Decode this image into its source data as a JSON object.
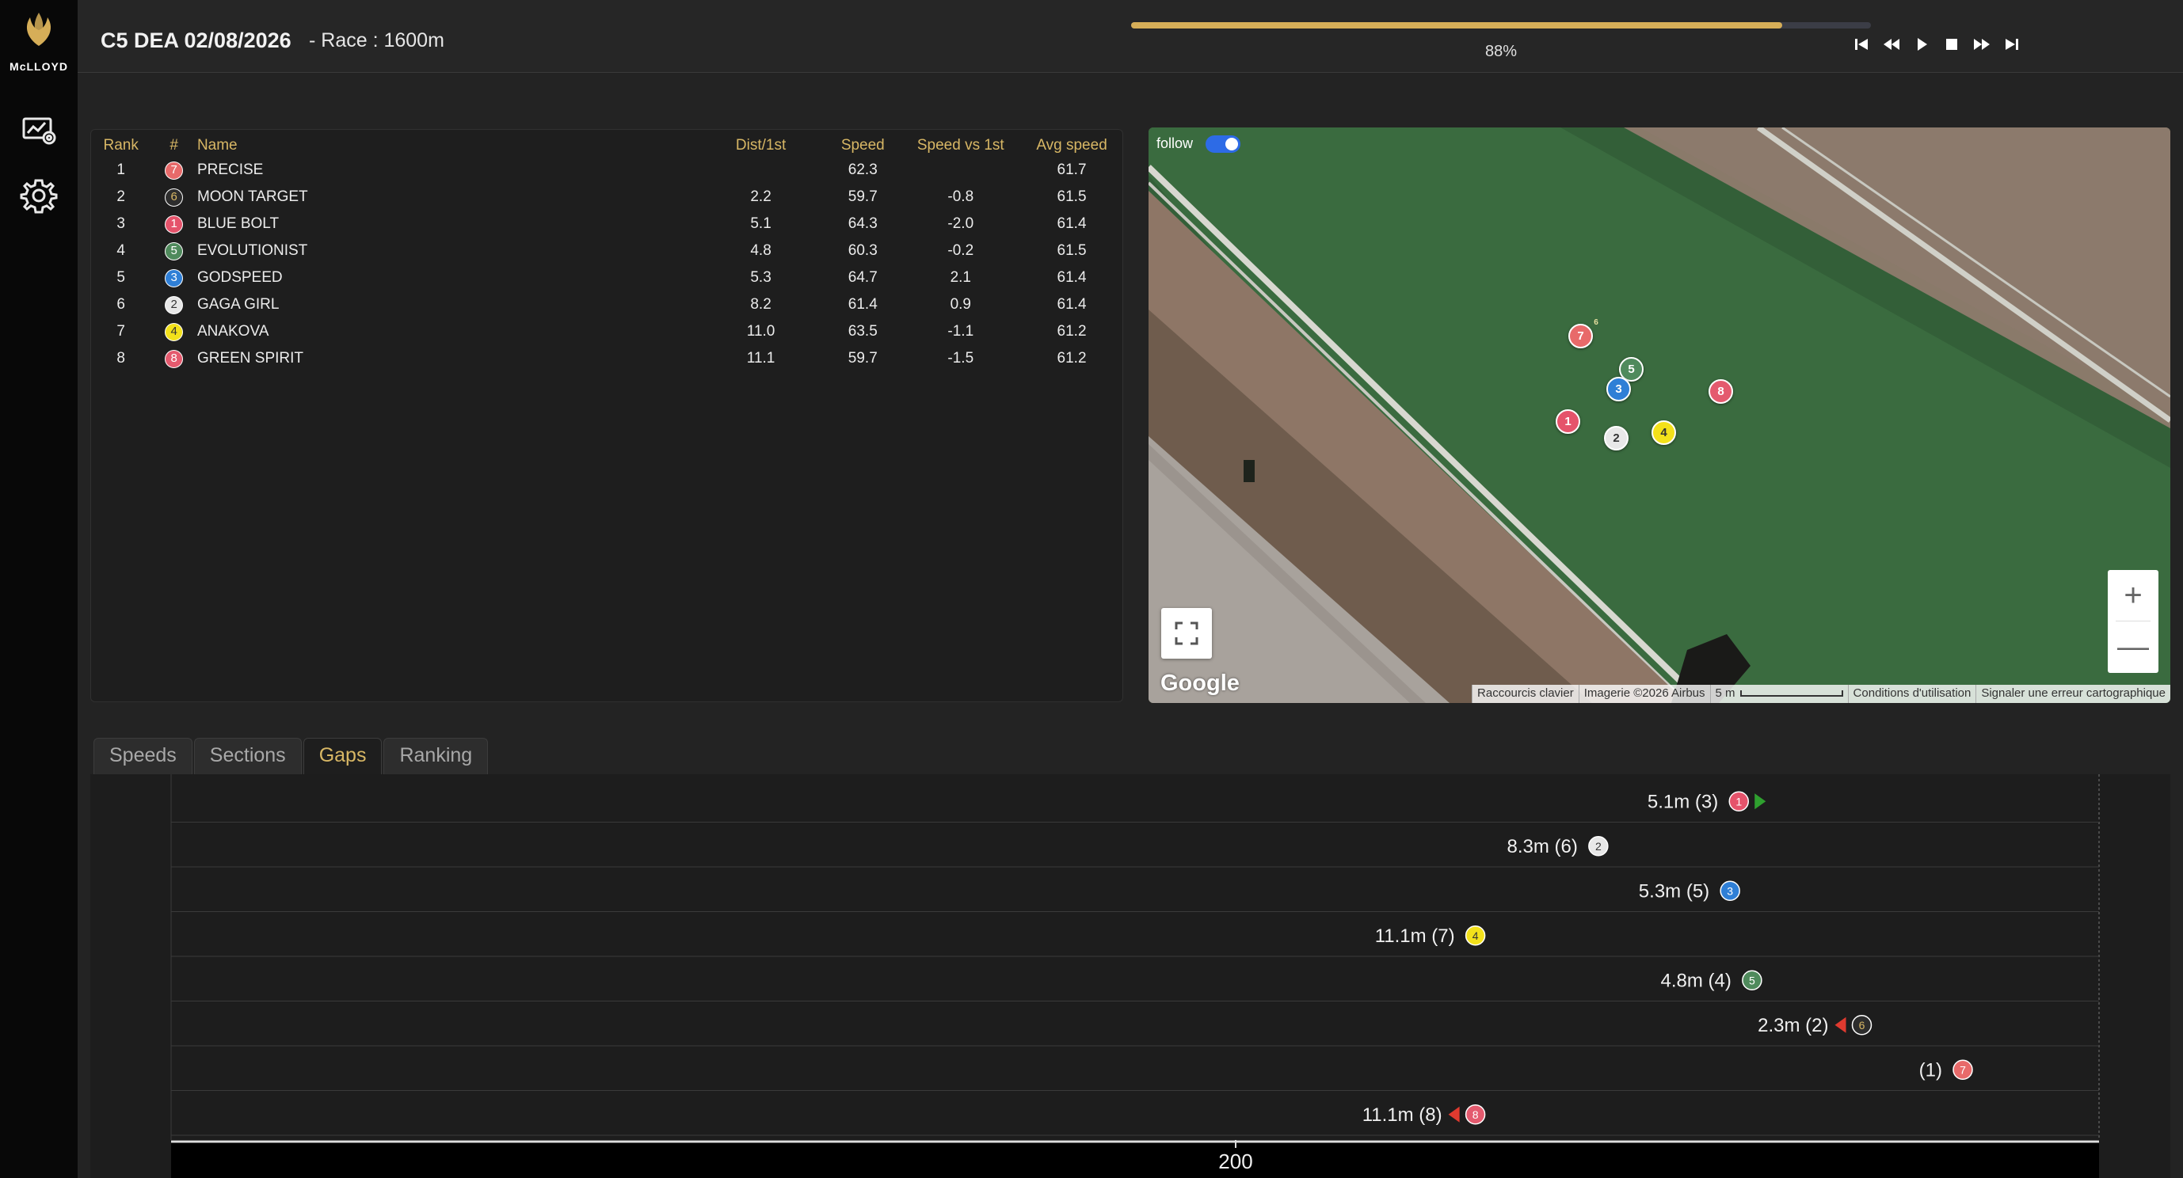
{
  "app": {
    "logo_text": "McLLOYD"
  },
  "header": {
    "race_title": "C5 DEA 02/08/2026",
    "race_distance": "- Race : 1600m",
    "progress_percent": 88,
    "progress_label": "88%"
  },
  "sidebar": {
    "items": [
      {
        "icon": "monitor-chart-icon"
      },
      {
        "icon": "gear-icon"
      }
    ]
  },
  "playback": [
    "skip-start-icon",
    "rewind-icon",
    "play-icon",
    "stop-icon",
    "fast-forward-icon",
    "skip-end-icon"
  ],
  "ranking": {
    "headers": {
      "rank": "Rank",
      "num": "#",
      "name": "Name",
      "dist": "Dist/1st",
      "speed": "Speed",
      "svf": "Speed vs 1st",
      "avg": "Avg speed"
    },
    "rows": [
      {
        "rank": "1",
        "num": "7",
        "name": "PRECISE",
        "dist": "",
        "speed": "62.3",
        "svf": "",
        "avg": "61.7"
      },
      {
        "rank": "2",
        "num": "6",
        "name": "MOON TARGET",
        "dist": "2.2",
        "speed": "59.7",
        "svf": "-0.8",
        "avg": "61.5"
      },
      {
        "rank": "3",
        "num": "1",
        "name": "BLUE BOLT",
        "dist": "5.1",
        "speed": "64.3",
        "svf": "-2.0",
        "avg": "61.4"
      },
      {
        "rank": "4",
        "num": "5",
        "name": "EVOLUTIONIST",
        "dist": "4.8",
        "speed": "60.3",
        "svf": "-0.2",
        "avg": "61.5"
      },
      {
        "rank": "5",
        "num": "3",
        "name": "GODSPEED",
        "dist": "5.3",
        "speed": "64.7",
        "svf": "2.1",
        "avg": "61.4"
      },
      {
        "rank": "6",
        "num": "2",
        "name": "GAGA GIRL",
        "dist": "8.2",
        "speed": "61.4",
        "svf": "0.9",
        "avg": "61.4"
      },
      {
        "rank": "7",
        "num": "4",
        "name": "ANAKOVA",
        "dist": "11.0",
        "speed": "63.5",
        "svf": "-1.1",
        "avg": "61.2"
      },
      {
        "rank": "8",
        "num": "8",
        "name": "GREEN SPIRIT",
        "dist": "11.1",
        "speed": "59.7",
        "svf": "-1.5",
        "avg": "61.2"
      }
    ]
  },
  "saddle_colors": {
    "1": {
      "bg": "#e5536b",
      "fg": "#ffffff"
    },
    "2": {
      "bg": "#e8e8e8",
      "fg": "#333333"
    },
    "3": {
      "bg": "#2f7fd6",
      "fg": "#ffffff"
    },
    "4": {
      "bg": "#f3e11b",
      "fg": "#333333"
    },
    "5": {
      "bg": "#4f8a5c",
      "fg": "#ffffff"
    },
    "6": {
      "bg": "#2d2d2d",
      "fg": "#d8b765"
    },
    "7": {
      "bg": "#e86a6a",
      "fg": "#ffffff"
    },
    "8": {
      "bg": "#e45a6e",
      "fg": "#ffffff"
    }
  },
  "map": {
    "follow_label": "follow",
    "google_label": "Google",
    "attribution": {
      "shortcuts": "Raccourcis clavier",
      "imagery": "Imagerie ©2026 Airbus",
      "scale": "5 m",
      "terms": "Conditions d'utilisation",
      "report": "Signaler une erreur cartographique"
    },
    "horses": [
      "7",
      "6",
      "5",
      "3",
      "8",
      "1",
      "2",
      "4"
    ]
  },
  "tabs": [
    {
      "label": "Speeds",
      "active": false
    },
    {
      "label": "Sections",
      "active": false
    },
    {
      "label": "Gaps",
      "active": true
    },
    {
      "label": "Ranking",
      "active": false
    }
  ],
  "chart_data": {
    "type": "bar",
    "x_ticks": [
      "200"
    ],
    "series": [
      {
        "num": "1",
        "gap_m": 5.1,
        "label": "5.1m (3)",
        "trend": "up"
      },
      {
        "num": "2",
        "gap_m": 8.3,
        "label": "8.3m (6)",
        "trend": "none"
      },
      {
        "num": "3",
        "gap_m": 5.3,
        "label": "5.3m (5)",
        "trend": "none"
      },
      {
        "num": "4",
        "gap_m": 11.1,
        "label": "11.1m (7)",
        "trend": "none"
      },
      {
        "num": "5",
        "gap_m": 4.8,
        "label": "4.8m (4)",
        "trend": "none"
      },
      {
        "num": "6",
        "gap_m": 2.3,
        "label": "2.3m (2)",
        "trend": "down"
      },
      {
        "num": "7",
        "gap_m": 0,
        "label": "(1)",
        "trend": "none"
      },
      {
        "num": "8",
        "gap_m": 11.1,
        "label": "11.1m (8)",
        "trend": "down"
      }
    ]
  }
}
